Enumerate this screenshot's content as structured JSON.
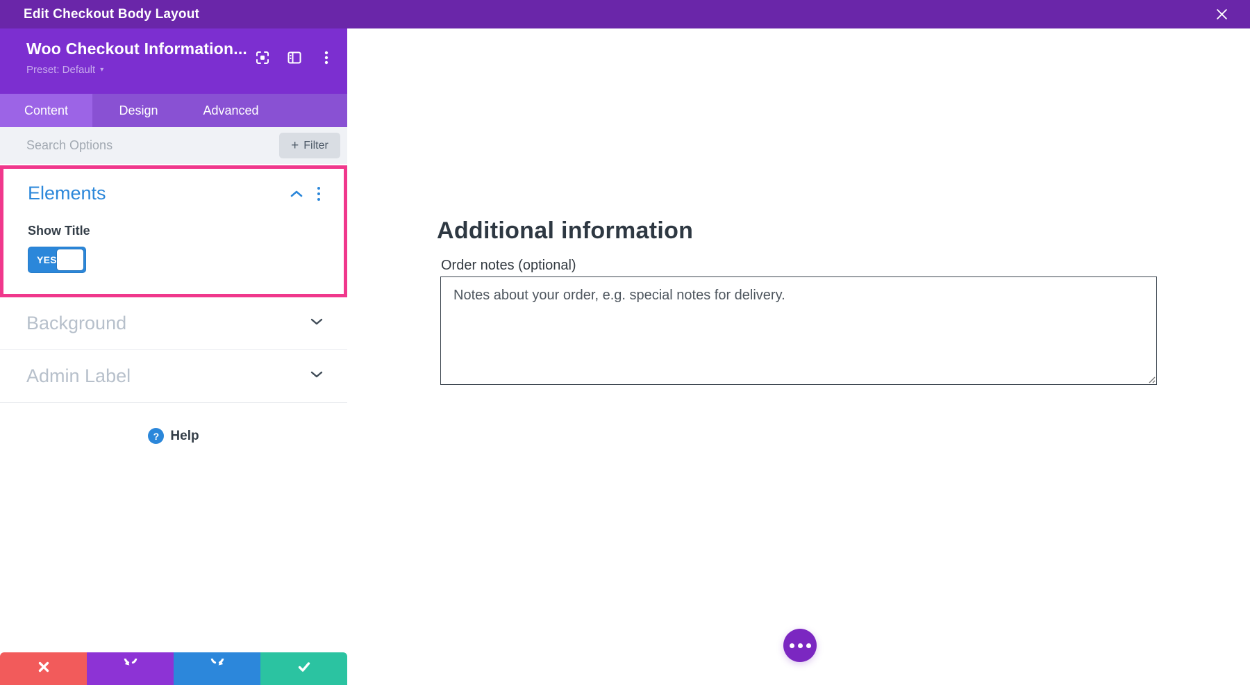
{
  "topbar": {
    "title": "Edit Checkout Body Layout"
  },
  "module_header": {
    "title": "Woo Checkout Information...",
    "preset_label": "Preset: Default",
    "preset_caret": "▾"
  },
  "tabs": [
    {
      "label": "Content",
      "active": true
    },
    {
      "label": "Design",
      "active": false
    },
    {
      "label": "Advanced",
      "active": false
    }
  ],
  "search": {
    "placeholder": "Search Options",
    "filter_label": "Filter",
    "filter_plus": "+"
  },
  "sections": {
    "elements": {
      "title": "Elements",
      "fields": [
        {
          "label": "Show Title",
          "type": "toggle",
          "value": "YES",
          "state": "on"
        }
      ]
    },
    "background": {
      "title": "Background",
      "collapsed": true
    },
    "admin_label": {
      "title": "Admin Label",
      "collapsed": true
    }
  },
  "help": {
    "icon_glyph": "?",
    "label": "Help"
  },
  "footer_buttons": [
    {
      "name": "discard",
      "icon": "x-mark-icon",
      "color": "#F25B5B"
    },
    {
      "name": "undo",
      "icon": "undo-arrow-icon",
      "color": "#8D33D5"
    },
    {
      "name": "redo",
      "icon": "redo-arrow-icon",
      "color": "#2C87DB"
    },
    {
      "name": "save",
      "icon": "check-mark-icon",
      "color": "#2BC3A1"
    }
  ],
  "preview": {
    "heading": "Additional information",
    "order_notes_label": "Order notes (optional)",
    "order_notes_value": "",
    "order_notes_placeholder": "Notes about your order, e.g. special notes for delivery."
  },
  "colors": {
    "topbar_purple": "#6A26A9",
    "module_header_purple": "#7C2FD0",
    "tabbar_purple": "#8951D3",
    "active_tab_purple": "#9C64E6",
    "accent_blue": "#2B87DA",
    "highlight_pink": "#F0388C",
    "muted_section_text": "#B7C0CB",
    "fab_purple": "#7B27C1"
  }
}
